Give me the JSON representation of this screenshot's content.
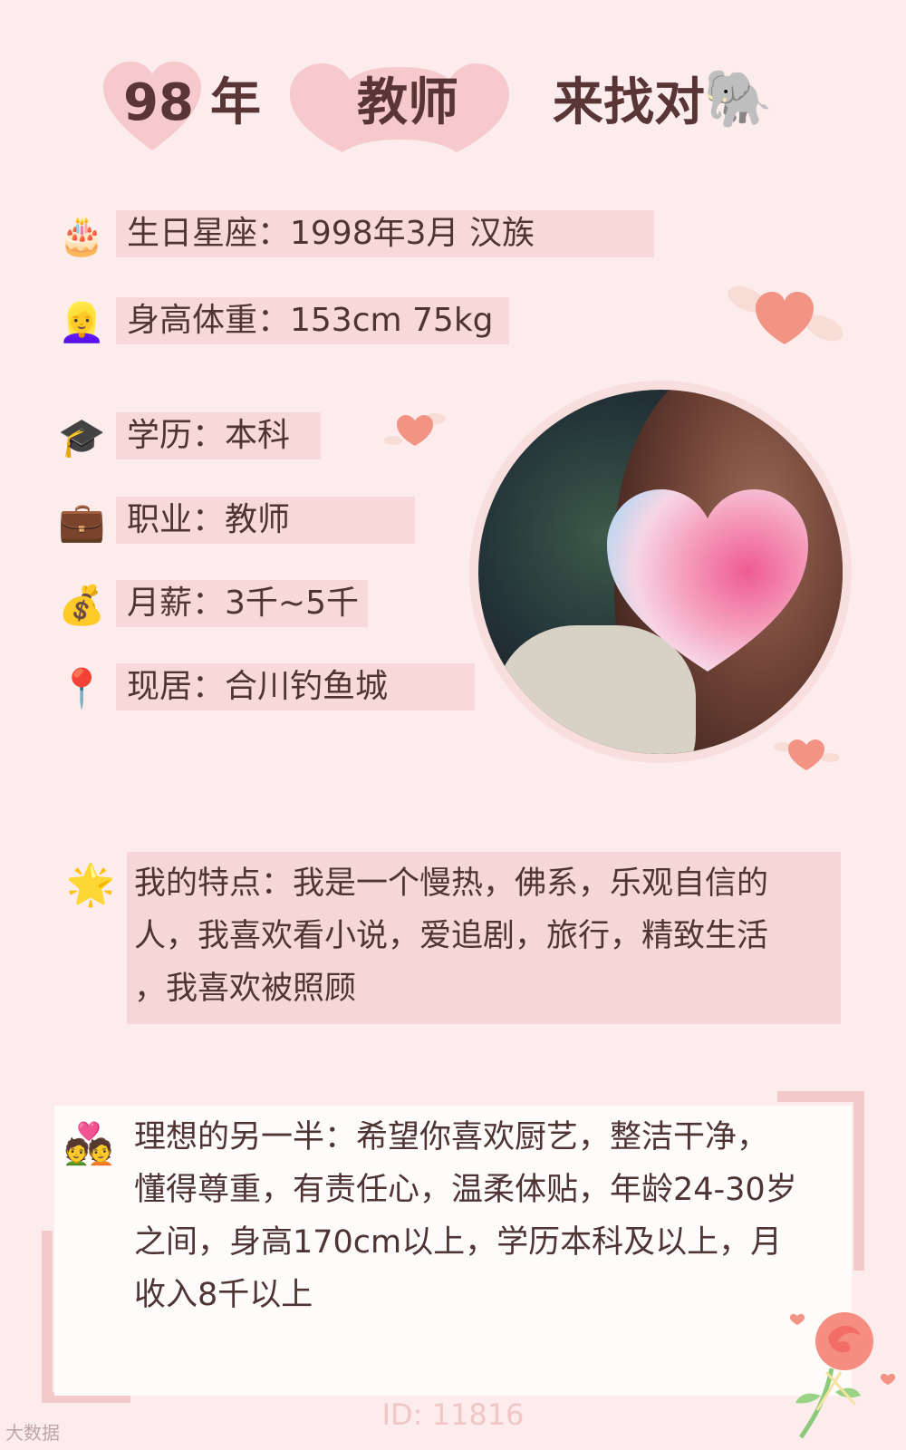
{
  "header": {
    "year_num": "98",
    "year_suffix": "年",
    "job": "教师",
    "tagline": "来找对",
    "elephant_icon": "🐘"
  },
  "info_rows": [
    {
      "icon": "🎂",
      "icon_name": "cake-icon",
      "text": "生日星座：1998年3月 汉族"
    },
    {
      "icon": "👱‍♀️",
      "icon_name": "woman-icon",
      "text": "身高体重：153cm 75kg"
    },
    {
      "icon": "🎓",
      "icon_name": "graduation-cap-icon",
      "text": "学历：本科"
    },
    {
      "icon": "💼",
      "icon_name": "briefcase-icon",
      "text": "职业：教师"
    },
    {
      "icon": "💰",
      "icon_name": "money-bag-icon",
      "text": "月薪：3千~5千"
    },
    {
      "icon": "📍",
      "icon_name": "location-pin-icon",
      "text": "现居：合川钓鱼城"
    }
  ],
  "features": {
    "icon": "🌟",
    "lines": [
      "我的特点：我是一个慢热，佛系，乐观自信的",
      "人，我喜欢看小说，爱追剧，旅行，精致生活",
      "，我喜欢被照顾"
    ]
  },
  "ideal": {
    "icon": "💑",
    "lines": [
      "理想的另一半：希望你喜欢厨艺，整洁干净，",
      "懂得尊重，有责任心，温柔体贴，年龄24-30岁",
      "之间，身高170cm以上，学历本科及以上，月",
      "收入8千以上"
    ]
  },
  "id_label": "ID: 11816",
  "watermark": "大数据"
}
